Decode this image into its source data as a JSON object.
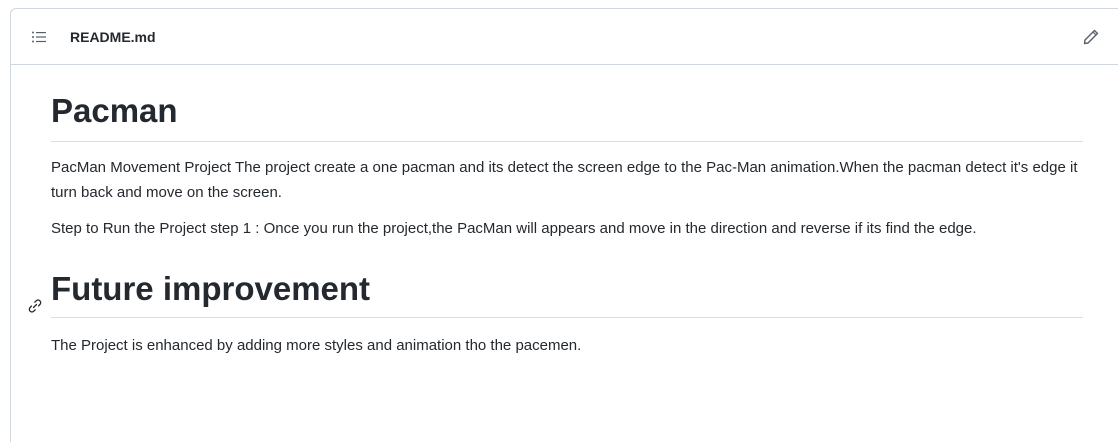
{
  "header": {
    "toc_icon": "list-unordered-icon",
    "filename": "README.md",
    "edit_icon": "pencil-icon"
  },
  "readme": {
    "title": "Pacman",
    "intro": "PacMan Movement Project The project create a one pacman and its detect the screen edge to the Pac-Man animation.When the pacman detect it's edge it turn back and move on the screen.",
    "steps": "Step to Run the Project step 1 : Once you run the project,the PacMan will appears and move in the direction and reverse if its find the edge.",
    "section_title": "Future improvement",
    "section_anchor_icon": "link-icon",
    "section_body": "The Project is enhanced by adding more styles and animation tho the pacemen."
  }
}
